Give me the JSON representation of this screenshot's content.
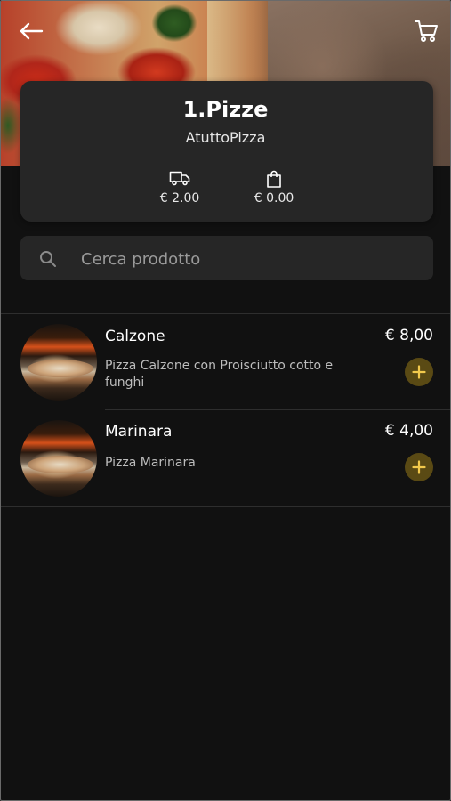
{
  "colors": {
    "background": "#111111",
    "card": "#262626",
    "accent": "#f2c94c",
    "add_button_bg": "#5a4a14"
  },
  "header": {
    "back_icon": "arrow-left-icon",
    "cart_icon": "shopping-cart-icon"
  },
  "store": {
    "title": "1.Pizze",
    "subtitle": "AtuttoPizza",
    "delivery_icon": "truck-icon",
    "delivery_cost": "€ 2.00",
    "min_order_icon": "shopping-bag-icon",
    "min_order": "€ 0.00"
  },
  "search": {
    "icon": "search-icon",
    "placeholder": "Cerca prodotto",
    "value": ""
  },
  "products": [
    {
      "name": "Calzone",
      "description": "Pizza Calzone con Proisciutto cotto e funghi",
      "price": "€ 8,00",
      "add_icon": "plus-icon"
    },
    {
      "name": "Marinara",
      "description": "Pizza Marinara",
      "price": "€ 4,00",
      "add_icon": "plus-icon"
    }
  ]
}
